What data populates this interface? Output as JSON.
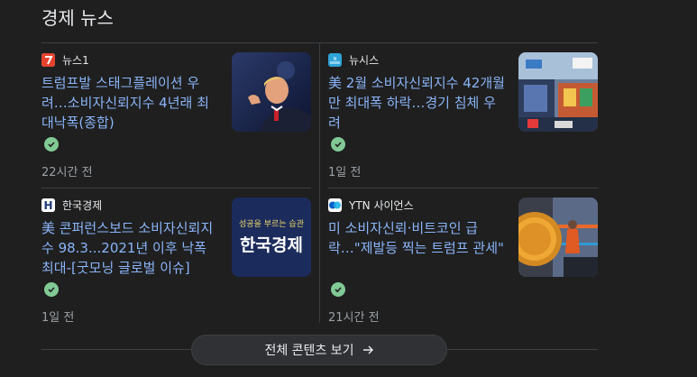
{
  "section": {
    "title": "경제 뉴스"
  },
  "cards": [
    {
      "source": "뉴스1",
      "headline": "트럼프발 스태그플레이션 우려…소비자신뢰지수 4년래 최대낙폭(종합)",
      "time": "22시간 전",
      "logo_color": "#e5412d",
      "thumb_icon": "trump-photo"
    },
    {
      "source": "뉴시스",
      "headline": "美 2월 소비자신뢰지수 42개월만 최대폭 하락…경기 침체 우려",
      "time": "1일 전",
      "logo_color": "#2fa3d8",
      "thumb_icon": "store-photo"
    },
    {
      "source": "한국경제",
      "headline": "美 콘퍼런스보드 소비자신뢰지수 98.3...2021년 이후 낙폭 최대-[굿모닝 글로벌 이슈]",
      "time": "1일 전",
      "logo_color": "#1c3a78",
      "logo_letter": "H",
      "thumb_subtitle": "성공을 부르는 습관",
      "thumb_title": "한국경제"
    },
    {
      "source": "YTN 사이언스",
      "headline": "미 소비자신뢰·비트코인 급락…\"제발등 찍는 트럼프 관세\"",
      "time": "21시간 전",
      "logo_color": "#0a60c8",
      "thumb_icon": "bitcoin-photo"
    }
  ],
  "more_button": {
    "label": "전체 콘텐츠 보기"
  }
}
